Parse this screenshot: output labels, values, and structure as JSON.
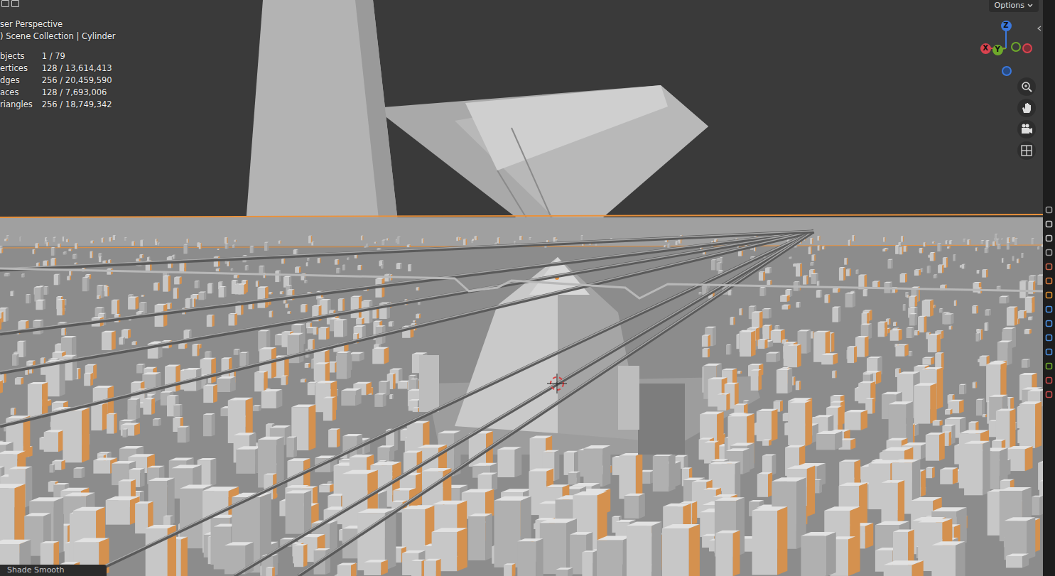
{
  "viewport": {
    "title": "ser Perspective",
    "collection": ") Scene Collection | Cylinder"
  },
  "stats": [
    {
      "label": "bjects",
      "value": "1 / 79"
    },
    {
      "label": "ertices",
      "value": "128 / 13,614,413"
    },
    {
      "label": "dges",
      "value": "256 / 20,459,590"
    },
    {
      "label": "aces",
      "value": "128 / 7,693,006"
    },
    {
      "label": "riangles",
      "value": "256 / 18,749,342"
    }
  ],
  "options_button": "Options",
  "gizmo": [
    {
      "label": "Z",
      "color": "#3b78dd"
    },
    {
      "label": "X",
      "color": "#d9434f"
    },
    {
      "label": "Y",
      "color": "#6ea92b"
    }
  ],
  "operator_panel": "Shade Smooth"
}
